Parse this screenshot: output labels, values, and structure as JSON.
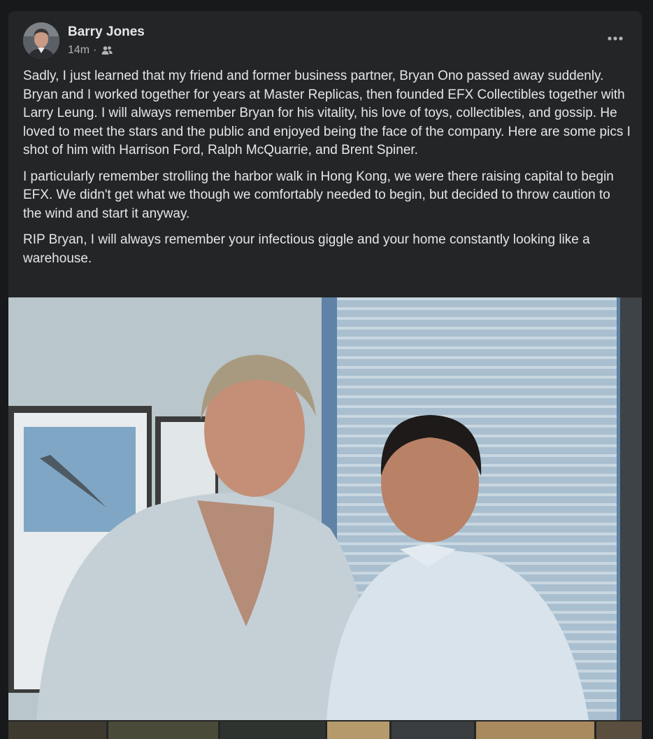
{
  "post": {
    "author_name": "Barry Jones",
    "timestamp": "14m",
    "separator": "·",
    "audience_icon": "friends-icon",
    "more_icon": "more-options-icon",
    "paragraphs": [
      "Sadly, I just learned that my friend and former business partner, Bryan Ono passed away suddenly. Bryan and I worked together for years at Master Replicas, then founded EFX Collectibles together with Larry Leung. I will always remember Bryan for his vitality, his love of toys, collectibles, and gossip. He loved to meet the stars and the public and enjoyed being the face of the company. Here are some pics I shot of him with Harrison Ford, Ralph McQuarrie, and Brent Spiner.",
      "I particularly remember strolling the harbor walk in Hong Kong, we were there raising capital to begin EFX. We didn't get what we though we comfortably needed to begin, but decided to throw caution to the wind and start it anyway.",
      "RIP Bryan, I will always remember your infectious giggle and your home constantly looking like a warehouse."
    ]
  },
  "colors": {
    "page_background": "#18191a",
    "card_background": "#242526",
    "primary_text": "#e4e6eb",
    "secondary_text": "#b0b3b8"
  }
}
